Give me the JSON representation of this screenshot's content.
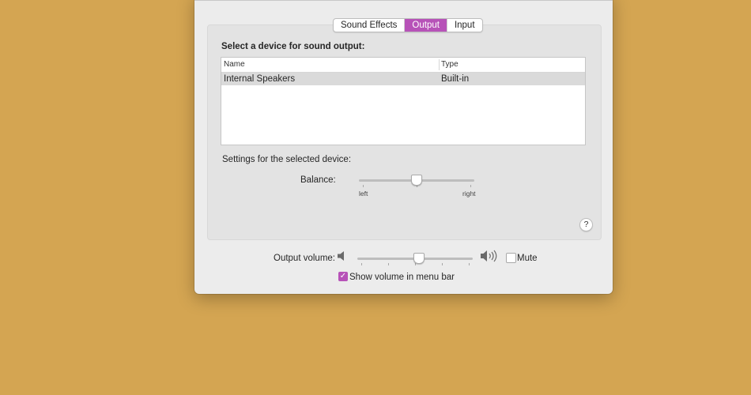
{
  "tabs": [
    {
      "label": "Sound Effects",
      "active": false
    },
    {
      "label": "Output",
      "active": true
    },
    {
      "label": "Input",
      "active": false
    }
  ],
  "output": {
    "section_title": "Select a device for sound output:",
    "columns": [
      "Name",
      "Type"
    ],
    "rows": [
      {
        "name": "Internal Speakers",
        "type": "Built-in",
        "selected": true
      }
    ],
    "settings_label": "Settings for the selected device:",
    "balance": {
      "label": "Balance:",
      "left_label": "left",
      "right_label": "right",
      "value": 0.5
    },
    "help_label": "?"
  },
  "volume": {
    "label": "Output volume:",
    "value": 0.54,
    "mute_label": "Mute",
    "mute_checked": false,
    "show_in_menu_bar_label": "Show volume in menu bar",
    "show_in_menu_bar_checked": true
  },
  "icons": {
    "speaker_low": "speaker-low-icon",
    "speaker_high": "speaker-high-icon",
    "checkmark": "checkmark-icon"
  },
  "colors": {
    "desktop": "#d4a552",
    "accent": "#b752b8",
    "window": "#ececec"
  }
}
